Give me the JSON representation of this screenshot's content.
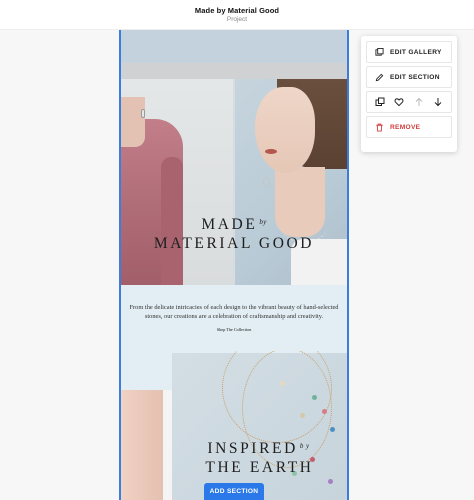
{
  "header": {
    "title": "Made by Material Good",
    "subtitle": "Project"
  },
  "hero": {
    "title_line1": "MADE",
    "title_by": "by",
    "title_line2": "MATERIAL GOOD"
  },
  "intro": {
    "paragraph": "From the delicate intricacies of each design to the vibrant beauty of hand-selected stones, our creations are a celebration of craftsmanship and creativity.",
    "link_label": "Shop The Collection"
  },
  "inspired": {
    "title_line1": "INSPIRED",
    "title_by": "by",
    "title_line2": "THE EARTH"
  },
  "add_section_label": "ADD SECTION",
  "toolbar": {
    "edit_gallery_label": "EDIT GALLERY",
    "edit_section_label": "EDIT SECTION",
    "remove_label": "REMOVE",
    "icons": [
      "duplicate-icon",
      "heart-icon",
      "arrow-up-icon",
      "arrow-down-icon"
    ]
  },
  "colors": {
    "accent": "#2b79e8",
    "selection_outline": "#3b7ddd",
    "remove": "#d23b3b"
  }
}
